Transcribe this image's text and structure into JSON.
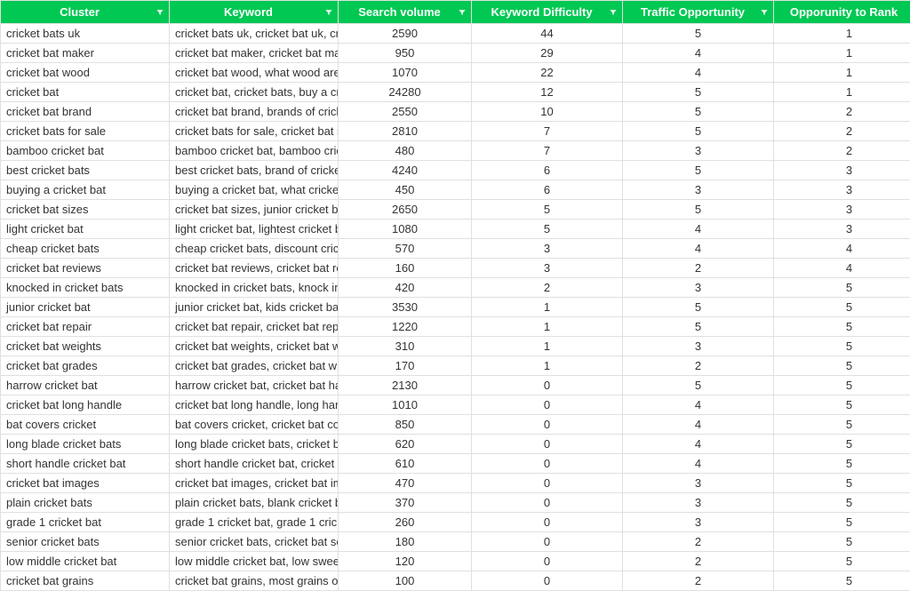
{
  "headers": {
    "cluster": "Cluster",
    "keyword": "Keyword",
    "volume": "Search volume",
    "difficulty": "Keyword Difficulty",
    "opportunity": "Traffic Opportunity",
    "rank": "Opporunity to Rank"
  },
  "rows": [
    {
      "cluster": "cricket bats uk",
      "keyword": "cricket bats uk, cricket bat uk, cric",
      "volume": "2590",
      "difficulty": "44",
      "opportunity": "5",
      "rank": "1"
    },
    {
      "cluster": "cricket bat maker",
      "keyword": "cricket bat maker, cricket bat mak",
      "volume": "950",
      "difficulty": "29",
      "opportunity": "4",
      "rank": "1"
    },
    {
      "cluster": "cricket bat wood",
      "keyword": "cricket bat wood, what wood are",
      "volume": "1070",
      "difficulty": "22",
      "opportunity": "4",
      "rank": "1"
    },
    {
      "cluster": "cricket bat",
      "keyword": "cricket bat, cricket bats, buy a cric",
      "volume": "24280",
      "difficulty": "12",
      "opportunity": "5",
      "rank": "1"
    },
    {
      "cluster": "cricket bat brand",
      "keyword": "cricket bat brand, brands of cricke",
      "volume": "2550",
      "difficulty": "10",
      "opportunity": "5",
      "rank": "2"
    },
    {
      "cluster": "cricket bats for sale",
      "keyword": "cricket bats for sale, cricket bat sa",
      "volume": "2810",
      "difficulty": "7",
      "opportunity": "5",
      "rank": "2"
    },
    {
      "cluster": "bamboo cricket bat",
      "keyword": "bamboo cricket bat, bamboo crick",
      "volume": "480",
      "difficulty": "7",
      "opportunity": "3",
      "rank": "2"
    },
    {
      "cluster": "best cricket bats",
      "keyword": "best cricket bats, brand of cricket",
      "volume": "4240",
      "difficulty": "6",
      "opportunity": "5",
      "rank": "3"
    },
    {
      "cluster": "buying a cricket bat",
      "keyword": "buying a cricket bat, what cricket",
      "volume": "450",
      "difficulty": "6",
      "opportunity": "3",
      "rank": "3"
    },
    {
      "cluster": "cricket bat sizes",
      "keyword": "cricket bat sizes, junior cricket bat",
      "volume": "2650",
      "difficulty": "5",
      "opportunity": "5",
      "rank": "3"
    },
    {
      "cluster": "light cricket bat",
      "keyword": "light cricket bat, lightest cricket b",
      "volume": "1080",
      "difficulty": "5",
      "opportunity": "4",
      "rank": "3"
    },
    {
      "cluster": "cheap cricket bats",
      "keyword": "cheap cricket bats, discount cricke",
      "volume": "570",
      "difficulty": "3",
      "opportunity": "4",
      "rank": "4"
    },
    {
      "cluster": "cricket bat reviews",
      "keyword": "cricket bat reviews, cricket bat rev",
      "volume": "160",
      "difficulty": "3",
      "opportunity": "2",
      "rank": "4"
    },
    {
      "cluster": "knocked in cricket bats",
      "keyword": "knocked in cricket bats, knock in c",
      "volume": "420",
      "difficulty": "2",
      "opportunity": "3",
      "rank": "5"
    },
    {
      "cluster": "junior cricket bat",
      "keyword": "junior cricket bat, kids cricket bat,",
      "volume": "3530",
      "difficulty": "1",
      "opportunity": "5",
      "rank": "5"
    },
    {
      "cluster": "cricket bat repair",
      "keyword": "cricket bat repair, cricket bat repa",
      "volume": "1220",
      "difficulty": "1",
      "opportunity": "5",
      "rank": "5"
    },
    {
      "cluster": "cricket bat weights",
      "keyword": "cricket bat weights, cricket bat we",
      "volume": "310",
      "difficulty": "1",
      "opportunity": "3",
      "rank": "5"
    },
    {
      "cluster": "cricket bat grades",
      "keyword": "cricket bat grades, cricket bat will",
      "volume": "170",
      "difficulty": "1",
      "opportunity": "2",
      "rank": "5"
    },
    {
      "cluster": "harrow cricket bat",
      "keyword": "harrow cricket bat, cricket bat har",
      "volume": "2130",
      "difficulty": "0",
      "opportunity": "5",
      "rank": "5"
    },
    {
      "cluster": "cricket bat long handle",
      "keyword": "cricket bat long handle, long hand",
      "volume": "1010",
      "difficulty": "0",
      "opportunity": "4",
      "rank": "5"
    },
    {
      "cluster": "bat covers cricket",
      "keyword": "bat covers cricket, cricket bat cov",
      "volume": "850",
      "difficulty": "0",
      "opportunity": "4",
      "rank": "5"
    },
    {
      "cluster": "long blade cricket bats",
      "keyword": "long blade cricket bats, cricket ba",
      "volume": "620",
      "difficulty": "0",
      "opportunity": "4",
      "rank": "5"
    },
    {
      "cluster": "short handle cricket bat",
      "keyword": "short handle cricket bat, cricket b",
      "volume": "610",
      "difficulty": "0",
      "opportunity": "4",
      "rank": "5"
    },
    {
      "cluster": "cricket bat images",
      "keyword": "cricket bat images, cricket bat ima",
      "volume": "470",
      "difficulty": "0",
      "opportunity": "3",
      "rank": "5"
    },
    {
      "cluster": "plain cricket bats",
      "keyword": "plain cricket bats, blank cricket ba",
      "volume": "370",
      "difficulty": "0",
      "opportunity": "3",
      "rank": "5"
    },
    {
      "cluster": "grade 1 cricket bat",
      "keyword": "grade 1 cricket bat, grade 1 cricke",
      "volume": "260",
      "difficulty": "0",
      "opportunity": "3",
      "rank": "5"
    },
    {
      "cluster": "senior cricket bats",
      "keyword": "senior cricket bats, cricket bat ser",
      "volume": "180",
      "difficulty": "0",
      "opportunity": "2",
      "rank": "5"
    },
    {
      "cluster": "low middle cricket bat",
      "keyword": "low middle cricket bat, low swee",
      "volume": "120",
      "difficulty": "0",
      "opportunity": "2",
      "rank": "5"
    },
    {
      "cluster": "cricket bat grains",
      "keyword": "cricket bat grains, most grains on",
      "volume": "100",
      "difficulty": "0",
      "opportunity": "2",
      "rank": "5"
    }
  ]
}
